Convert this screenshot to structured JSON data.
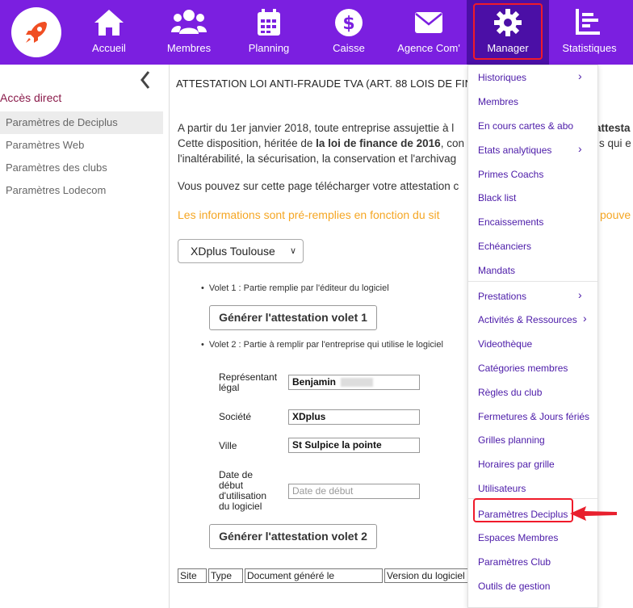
{
  "nav": {
    "items": [
      {
        "label": "Accueil",
        "icon": "home-icon"
      },
      {
        "label": "Membres",
        "icon": "users-icon"
      },
      {
        "label": "Planning",
        "icon": "calendar-icon"
      },
      {
        "label": "Caisse",
        "icon": "dollar-icon"
      },
      {
        "label": "Agence Com'",
        "icon": "envelope-icon"
      },
      {
        "label": "Manager",
        "icon": "gear-icon"
      },
      {
        "label": "Statistiques",
        "icon": "stats-icon"
      }
    ],
    "active": "Manager"
  },
  "sidebar": {
    "title": "Accès direct",
    "items": [
      {
        "label": "Paramètres de Deciplus"
      },
      {
        "label": "Paramètres Web"
      },
      {
        "label": "Paramètres des clubs"
      },
      {
        "label": "Paramètres Lodecom"
      }
    ]
  },
  "main": {
    "title": "ATTESTATION LOI ANTI-FRAUDE TVA (ART. 88 LOIS DE FIN",
    "para1": {
      "l1": "A partir du 1er janvier 2018, toute entreprise assujettie à l",
      "l1b": "attesta",
      "l2a": "Cette disposition, héritée de ",
      "l2b": "la loi de finance de 2016",
      "l2c": ", con",
      "l2d": "s qui e",
      "l3": "l'inaltérabilité, la sécurisation, la conservation et l'archivag"
    },
    "para2": "Vous pouvez sur cette page télécharger votre attestation c",
    "orange": "Les informations sont pré-remplies en fonction du sit",
    "orange_tail": "pouve",
    "site_select": "XDplus Toulouse",
    "volet1": "Volet 1 : Partie remplie par l'éditeur du logiciel",
    "btn1": "Générer l'attestation volet 1",
    "volet2": "Volet 2 : Partie à remplir par l'entreprise qui utilise le logiciel",
    "form": {
      "rep_label": "Représentant légal",
      "rep_value": "Benjamin",
      "societe_label": "Société",
      "societe_value": "XDplus",
      "ville_label": "Ville",
      "ville_value": "St Sulpice la pointe",
      "date_label": "Date de début d'utilisation du logiciel",
      "date_placeholder": "Date de début"
    },
    "btn2": "Générer l'attestation volet 2",
    "table_headers": [
      "Site",
      "Type",
      "Document généré le",
      "Version du logiciel"
    ]
  },
  "dropdown": {
    "items": [
      {
        "label": "Historiques",
        "sub": true
      },
      {
        "label": "Membres",
        "sub": false
      },
      {
        "label": "En cours cartes & abo",
        "sub": false
      },
      {
        "label": "Etats analytiques",
        "sub": true
      },
      {
        "label": "Primes Coachs",
        "sub": false
      },
      {
        "label": "Black list",
        "sub": false
      },
      {
        "label": "Encaissements",
        "sub": false
      },
      {
        "label": "Echéanciers",
        "sub": false
      },
      {
        "label": "Mandats",
        "sub": false
      },
      {
        "label": "Prestations",
        "sub": true
      },
      {
        "label": "Activités & Ressources",
        "sub": true
      },
      {
        "label": "Videothèque",
        "sub": false
      },
      {
        "label": "Catégories membres",
        "sub": false
      },
      {
        "label": "Règles du club",
        "sub": false
      },
      {
        "label": "Fermetures & Jours fériés",
        "sub": false
      },
      {
        "label": "Grilles planning",
        "sub": false
      },
      {
        "label": "Horaires par grille",
        "sub": false
      },
      {
        "label": "Utilisateurs",
        "sub": false
      },
      {
        "label": "Paramètres Deciplus",
        "sub": false
      },
      {
        "label": "Espaces Membres",
        "sub": false
      },
      {
        "label": "Paramètres Club",
        "sub": false
      },
      {
        "label": "Outils de gestion",
        "sub": false
      }
    ]
  },
  "colors": {
    "brand_purple": "#7b1fe0",
    "active_purple": "#4b0fa6",
    "highlight_red": "#f01a2a",
    "orange_text": "#f5a623"
  }
}
